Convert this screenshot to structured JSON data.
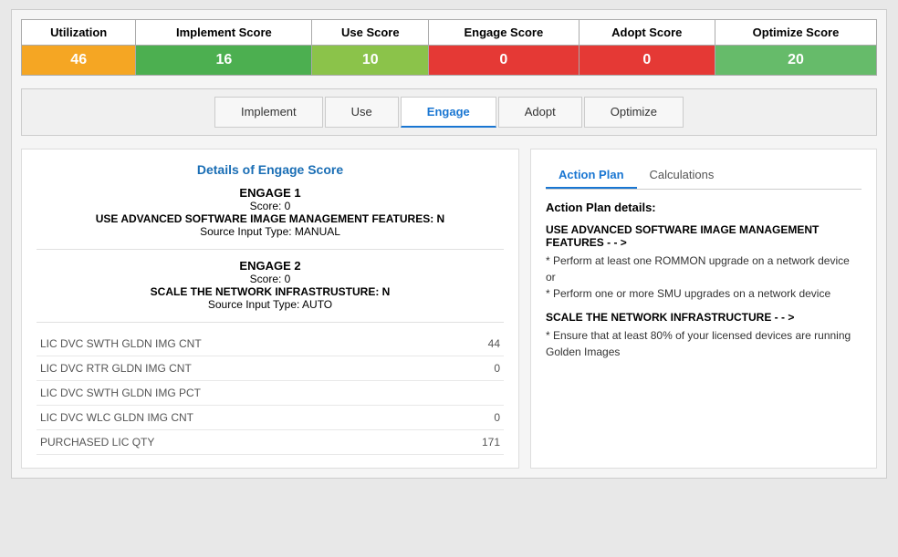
{
  "scoreTable": {
    "headers": [
      "Utilization",
      "Implement Score",
      "Use Score",
      "Engage Score",
      "Adopt Score",
      "Optimize Score"
    ],
    "values": [
      "46",
      "16",
      "10",
      "0",
      "0",
      "20"
    ],
    "colors": [
      "td-orange",
      "td-green-dark",
      "td-yellow-green",
      "td-red",
      "td-red2",
      "td-green-light"
    ]
  },
  "tabs": {
    "items": [
      "Implement",
      "Use",
      "Engage",
      "Adopt",
      "Optimize"
    ],
    "active": "Engage"
  },
  "leftPanel": {
    "title": "Details of Engage Score",
    "engage1": {
      "label": "ENGAGE 1",
      "score": "Score: 0",
      "feature": "USE ADVANCED SOFTWARE IMAGE MANAGEMENT FEATURES: N",
      "source": "Source Input Type: MANUAL"
    },
    "engage2": {
      "label": "ENGAGE 2",
      "score": "Score: 0",
      "feature": "SCALE THE NETWORK INFRASTRUSTURE: N",
      "source": "Source Input Type: AUTO"
    },
    "dataRows": [
      {
        "label": "LIC DVC SWTH GLDN IMG CNT",
        "value": "44"
      },
      {
        "label": "LIC DVC RTR GLDN IMG CNT",
        "value": "0"
      },
      {
        "label": "LIC DVC SWTH GLDN IMG PCT",
        "value": ""
      },
      {
        "label": "LIC DVC WLC GLDN IMG CNT",
        "value": "0"
      },
      {
        "label": "PURCHASED LIC QTY",
        "value": "171"
      }
    ]
  },
  "rightPanel": {
    "tabs": [
      "Action Plan",
      "Calculations"
    ],
    "activeTab": "Action Plan",
    "title": "Action Plan details:",
    "sections": [
      {
        "heading": "USE ADVANCED SOFTWARE IMAGE MANAGEMENT FEATURES - - >",
        "bullets": [
          "* Perform at least one ROMMON upgrade on a network device",
          "or",
          "* Perform one or more SMU upgrades on a network device"
        ]
      },
      {
        "heading": "SCALE THE NETWORK INFRASTRUCTURE - - >",
        "bullets": [
          "* Ensure that at least 80% of your licensed devices are running Golden Images"
        ]
      }
    ]
  }
}
